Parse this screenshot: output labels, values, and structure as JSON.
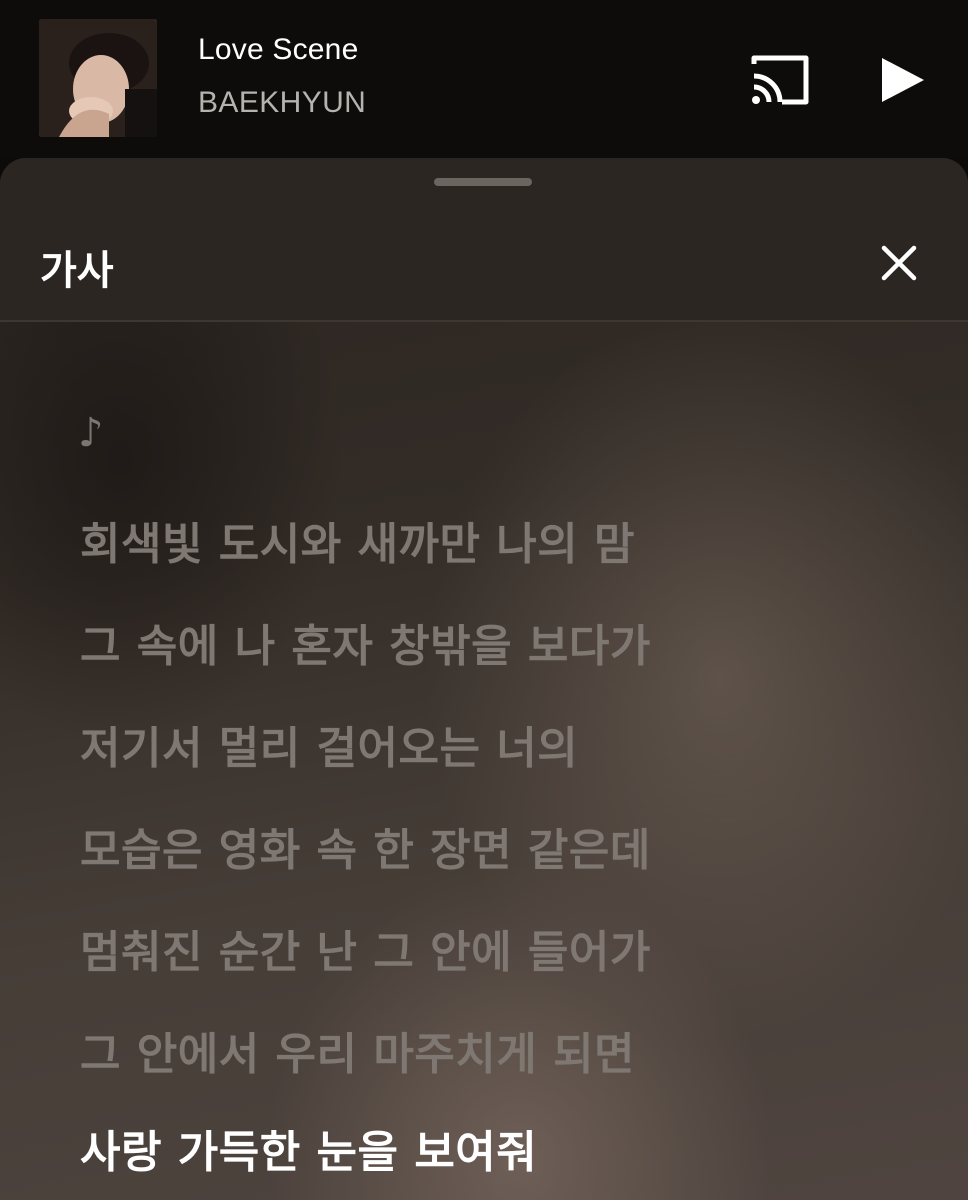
{
  "now_playing": {
    "title": "Love Scene",
    "artist": "BAEKHYUN",
    "album_art": "album-cover-portrait",
    "cast_icon": "cast-icon",
    "play_icon": "play-icon"
  },
  "lyrics_panel": {
    "title": "가사",
    "close_icon": "close-icon",
    "intro_marker": "♪",
    "lines": [
      "회색빛 도시와 새까만 나의 맘",
      "그 속에 나 혼자 창밖을 보다가",
      "저기서 멀리 걸어오는 너의",
      "모습은 영화 속 한 장면 같은데",
      "멈춰진 순간 난 그 안에 들어가",
      "그 안에서 우리 마주치게 되면",
      "사랑 가득한 눈을 보여줘"
    ],
    "active_line_index": 6
  },
  "colors": {
    "background": "#0d0b0a",
    "sheet_header": "#2c2622",
    "lyric_inactive": "#7e7772",
    "lyric_active": "#ffffff",
    "artist_text": "#b6b2ae"
  }
}
